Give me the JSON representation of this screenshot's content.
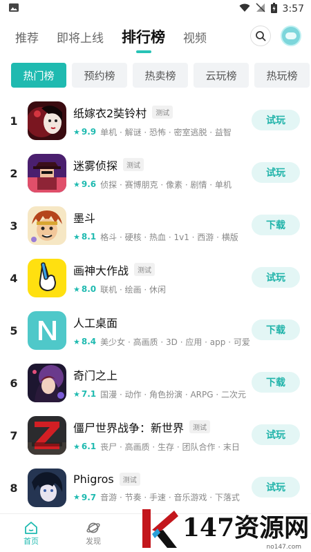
{
  "status": {
    "time": "3:57"
  },
  "header": {
    "tabs": [
      {
        "label": "推荐"
      },
      {
        "label": "即将上线"
      },
      {
        "label": "排行榜"
      },
      {
        "label": "视频"
      }
    ]
  },
  "chips": [
    {
      "label": "热门榜"
    },
    {
      "label": "预约榜"
    },
    {
      "label": "热卖榜"
    },
    {
      "label": "云玩榜"
    },
    {
      "label": "热玩榜"
    }
  ],
  "apps": [
    {
      "rank": "1",
      "name": "纸嫁衣2奘铃村",
      "badge": "测试",
      "score": "9.9",
      "tags": "单机 · 解谜 · 恐怖 · 密室逃脱 · 益智",
      "action": "试玩"
    },
    {
      "rank": "2",
      "name": "迷雾侦探",
      "badge": "测试",
      "score": "9.6",
      "tags": "侦探 · 赛博朋克 · 像素 · 剧情 · 单机",
      "action": "试玩"
    },
    {
      "rank": "3",
      "name": "墨斗",
      "badge": "",
      "score": "8.1",
      "tags": "格斗 · 硬核 · 热血 · 1v1 · 西游 · 横版",
      "action": "下载"
    },
    {
      "rank": "4",
      "name": "画神大作战",
      "badge": "测试",
      "score": "8.0",
      "tags": "联机 · 绘画 · 休闲",
      "action": "试玩"
    },
    {
      "rank": "5",
      "name": "人工桌面",
      "badge": "",
      "score": "8.4",
      "tags": "美少女 · 高画质 · 3D · 应用 · app · 可爱",
      "action": "下载"
    },
    {
      "rank": "6",
      "name": "奇门之上",
      "badge": "",
      "score": "7.1",
      "tags": "国漫 · 动作 · 角色扮演 · ARPG · 二次元",
      "action": "下载"
    },
    {
      "rank": "7",
      "name": "僵尸世界战争：新世界",
      "badge": "测试",
      "score": "6.1",
      "tags": "丧尸 · 高画质 · 生存 · 团队合作 · 末日",
      "action": "试玩"
    },
    {
      "rank": "8",
      "name": "Phigros",
      "badge": "测试",
      "score": "9.7",
      "tags": "音游 · 节奏 · 手速 · 音乐游戏 · 下落式",
      "action": "试玩"
    }
  ],
  "bottom_nav": [
    {
      "label": "首页"
    },
    {
      "label": "发现"
    }
  ],
  "watermark": {
    "text": "147资源网",
    "url": "no147.com"
  },
  "colors": {
    "accent": "#1fbab0",
    "action_bg": "#e3f6f5"
  }
}
